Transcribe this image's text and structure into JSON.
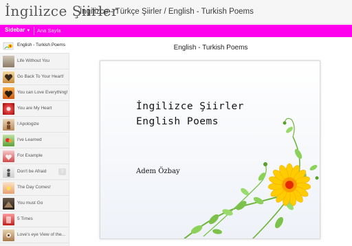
{
  "header": {
    "logo_text": "İngilizce Şiirler",
    "site_title": "İngilizce - Türkçe Şiirler / English - Turkish Poems"
  },
  "navbar": {
    "sidebar_label": "Sidebar",
    "home_label": "Ana Sayfa",
    "color": "#ff00ee"
  },
  "sidebar": {
    "items": [
      {
        "label": "English - Turkish Poems",
        "icon": "poems-book-icon",
        "active": true
      },
      {
        "label": "Life Without You",
        "icon": "poem-thumbnail-icon"
      },
      {
        "label": "Go Back To Your Heart!",
        "icon": "poem-thumbnail-icon"
      },
      {
        "label": "You can Love Everything!",
        "icon": "poem-thumbnail-icon"
      },
      {
        "label": "You are My Heart",
        "icon": "poem-thumbnail-icon"
      },
      {
        "label": "I Apologize",
        "icon": "poem-thumbnail-icon"
      },
      {
        "label": "I've Learned",
        "icon": "poem-thumbnail-icon"
      },
      {
        "label": "For Example",
        "icon": "poem-thumbnail-icon"
      },
      {
        "label": "Don't be Afraid",
        "icon": "poem-thumbnail-icon",
        "badge": "2"
      },
      {
        "label": "The Day Comes!",
        "icon": "poem-thumbnail-icon"
      },
      {
        "label": "You must Go",
        "icon": "poem-thumbnail-icon"
      },
      {
        "label": "5 Times",
        "icon": "poem-thumbnail-icon"
      },
      {
        "label": "Love's eye View of the...",
        "icon": "poem-thumbnail-icon"
      }
    ]
  },
  "main": {
    "title": "English - Turkish Poems",
    "card": {
      "line1": "İngilizce Şiirler",
      "line2": "English Poems",
      "author": "Adem Özbay"
    }
  }
}
